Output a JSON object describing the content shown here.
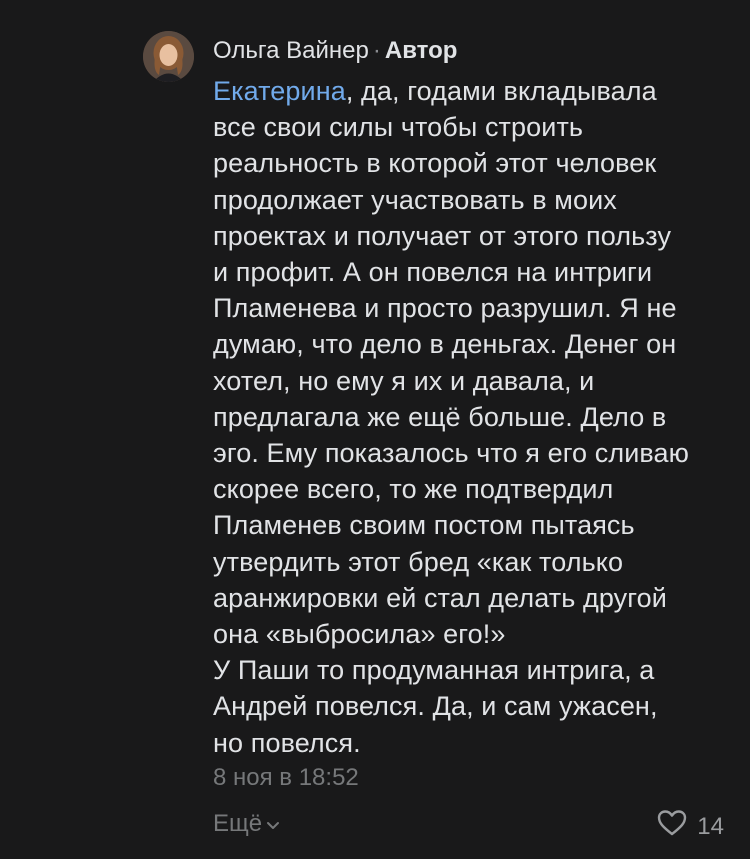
{
  "comment": {
    "author": "Ольга Вайнер",
    "separator": "·",
    "author_tag": "Автор",
    "mention": "Екатерина",
    "text_rest": ", да, годами вкладывала\nвсе свои силы чтобы строить\nреальность в которой этот человек\nпродолжает участвовать в моих\nпроектах и получает от этого пользу\nи профит. А он повелся на интриги\nПламенева и просто разрушил. Я не\nдумаю, что дело в деньгах. Денег он\nхотел, но ему я их и давала, и\nпредлагала же ещё больше. Дело в\nэго. Ему показалось что я его сливаю\nскорее всего, то же подтвердил\nПламенев своим постом пытаясь\nутвердить этот бред «как только\nаранжировки ей стал делать другой\nона «выбросила» его!»\nУ Паши то продуманная интрига, а\nАндрей повелся. Да, и сам ужасен,\nно повелся.",
    "timestamp": "8 ноя в 18:52",
    "more_label": "Ещё",
    "likes_count": "14"
  },
  "colors": {
    "background": "#19191a",
    "text": "#e1e3e6",
    "mention": "#71aaeb",
    "secondary": "#76787a"
  },
  "icons": {
    "avatar": "avatar-photo",
    "more": "chevron-down-icon",
    "like": "heart-outline-icon"
  }
}
